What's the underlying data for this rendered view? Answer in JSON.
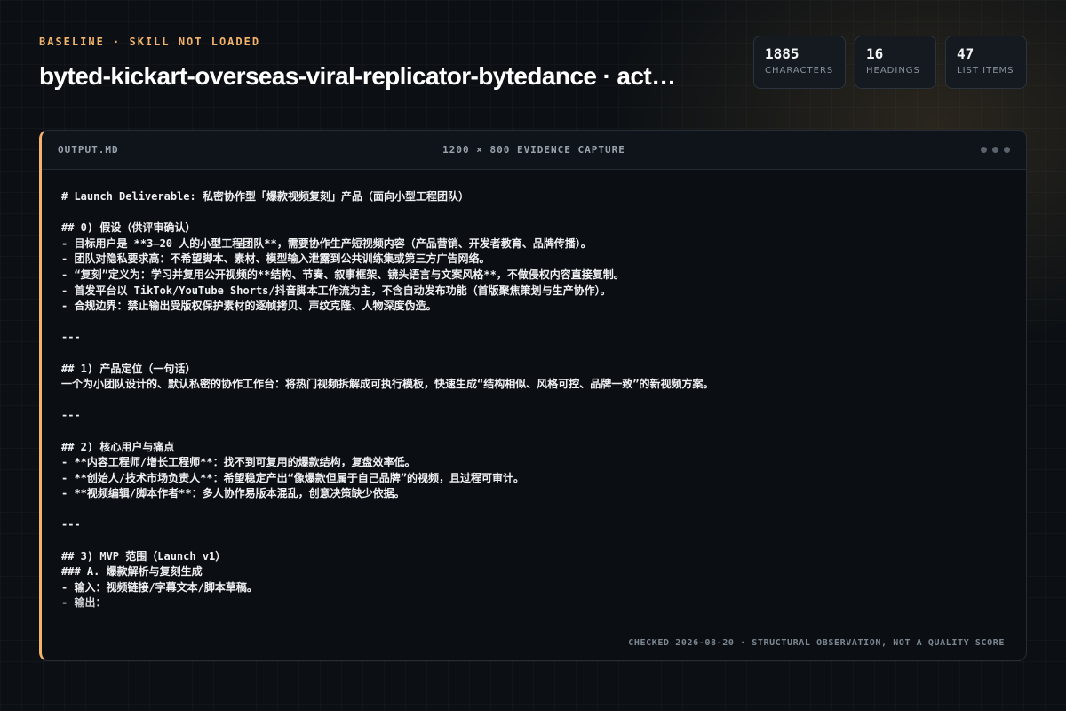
{
  "header": {
    "eyebrow": "BASELINE · SKILL NOT LOADED",
    "title": "byted-kickart-overseas-viral-replicator-bytedance · act…"
  },
  "stats": [
    {
      "value": "1885",
      "label": "CHARACTERS"
    },
    {
      "value": "16",
      "label": "HEADINGS"
    },
    {
      "value": "47",
      "label": "LIST ITEMS"
    }
  ],
  "panel": {
    "filename": "OUTPUT.MD",
    "caption": "1200 × 800 EVIDENCE CAPTURE",
    "footer": "CHECKED 2026-08-20 · STRUCTURAL OBSERVATION, NOT A QUALITY SCORE",
    "lines": [
      "# Launch Deliverable: 私密协作型「爆款视频复刻」产品（面向小型工程团队）",
      "",
      "## 0) 假设（供评审确认）",
      "- 目标用户是 **3–20 人的小型工程团队**，需要协作生产短视频内容（产品营销、开发者教育、品牌传播）。",
      "- 团队对隐私要求高：不希望脚本、素材、模型输入泄露到公共训练集或第三方广告网络。",
      "- “复刻”定义为：学习并复用公开视频的**结构、节奏、叙事框架、镜头语言与文案风格**，不做侵权内容直接复制。",
      "- 首发平台以 TikTok/YouTube Shorts/抖音脚本工作流为主，不含自动发布功能（首版聚焦策划与生产协作）。",
      "- 合规边界：禁止输出受版权保护素材的逐帧拷贝、声纹克隆、人物深度伪造。",
      "",
      "---",
      "",
      "## 1) 产品定位（一句话）",
      "一个为小团队设计的、默认私密的协作工作台：将热门视频拆解成可执行模板，快速生成“结构相似、风格可控、品牌一致”的新视频方案。",
      "",
      "---",
      "",
      "## 2) 核心用户与痛点",
      "- **内容工程师/增长工程师**：找不到可复用的爆款结构，复盘效率低。",
      "- **创始人/技术市场负责人**：希望稳定产出“像爆款但属于自己品牌”的视频，且过程可审计。",
      "- **视频编辑/脚本作者**：多人协作易版本混乱，创意决策缺少依据。",
      "",
      "---",
      "",
      "## 3) MVP 范围（Launch v1）",
      "### A. 爆款解析与复刻生成",
      "- 输入：视频链接/字幕文本/脚本草稿。",
      "- 输出："
    ]
  }
}
